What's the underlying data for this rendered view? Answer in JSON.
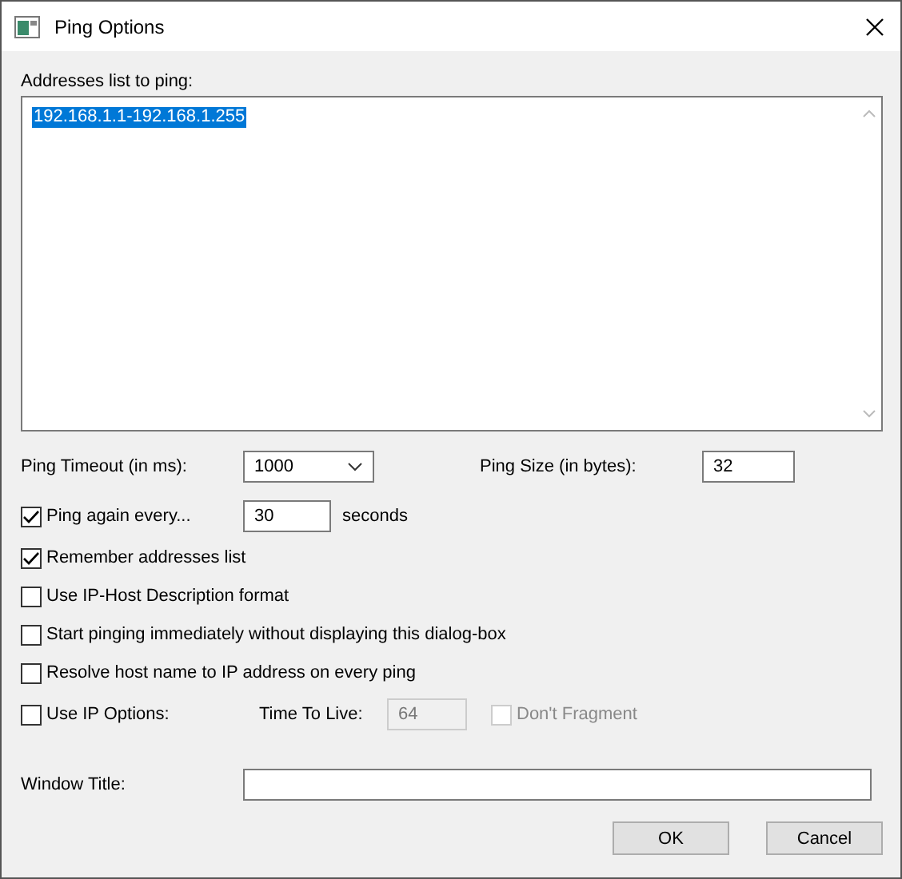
{
  "window": {
    "title": "Ping Options"
  },
  "addresses": {
    "label": "Addresses list to ping:",
    "value": "192.168.1.1-192.168.1.255",
    "selected": true
  },
  "timeout": {
    "label": "Ping Timeout (in ms):",
    "value": "1000"
  },
  "size": {
    "label": "Ping Size (in bytes):",
    "value": "32"
  },
  "repeat": {
    "label": "Ping again every...",
    "checked": true,
    "value": "30",
    "unit": "seconds"
  },
  "options": [
    {
      "label": "Remember addresses list",
      "checked": true
    },
    {
      "label": "Use IP-Host Description format",
      "checked": false
    },
    {
      "label": "Start pinging immediately without displaying this dialog-box",
      "checked": false
    },
    {
      "label": "Resolve host name to IP address on every ping",
      "checked": false
    }
  ],
  "ip_options": {
    "label": "Use IP Options:",
    "checked": false,
    "ttl_label": "Time To Live:",
    "ttl_value": "64",
    "disabled": true,
    "dont_fragment": {
      "label": "Don't Fragment",
      "checked": false,
      "disabled": true
    }
  },
  "window_title": {
    "label": "Window Title:"
  },
  "buttons": [
    "OK",
    "Cancel"
  ]
}
